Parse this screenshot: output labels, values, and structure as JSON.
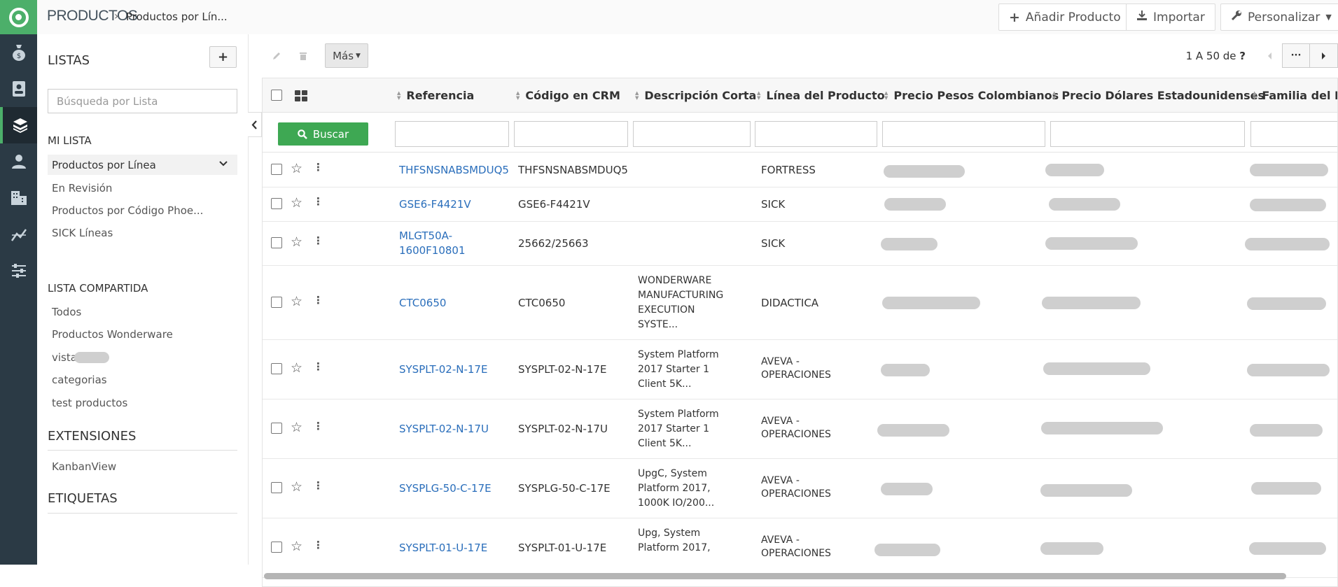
{
  "topbar": {
    "module": "PRODUCTOS",
    "breadcrumb": "Productos por Lín...",
    "add_label": "Añadir Producto",
    "import_label": "Importar",
    "customize_label": "Personalizar"
  },
  "sidebar": {
    "lists_title": "LISTAS",
    "add_symbol": "+",
    "search_placeholder": "Búsqueda por Lista",
    "my_list_title": "MI LISTA",
    "my_list": [
      "Productos por Línea",
      "En Revisión",
      "Productos por Código Phoe...",
      "SICK Líneas"
    ],
    "shared_title": "LISTA COMPARTIDA",
    "shared": [
      "Todos",
      "Productos Wonderware",
      "vista",
      "categorias",
      "test productos"
    ],
    "extensions_title": "EXTENSIONES",
    "extensions": [
      "KanbanView"
    ],
    "tags_title": "ETIQUETAS"
  },
  "toolbar": {
    "more_label": "Más",
    "pager_text": "1 A 50  de",
    "pager_total": "?",
    "more_dots": "···"
  },
  "table": {
    "columns": [
      "Referencia",
      "Código en CRM",
      "Descripción Corta",
      "Línea del Producto",
      "Precio Pesos Colombianos",
      "Precio Dólares Estadounidenses",
      "Familia del Pr"
    ],
    "search_label": "Buscar",
    "rows": [
      {
        "ref": "THFSNSNABSMDUQ5",
        "crm": "THFSNSNABSMDUQ5",
        "desc": "",
        "linea": "FORTRESS"
      },
      {
        "ref": "GSE6-F4421V",
        "crm": "GSE6-F4421V",
        "desc": "",
        "linea": "SICK"
      },
      {
        "ref": "MLGT50A-\n1600F10801",
        "crm": "25662/25663",
        "desc": "",
        "linea": "SICK"
      },
      {
        "ref": "CTC0650",
        "crm": "CTC0650",
        "desc": "WONDERWARE\nMANUFACTURING\nEXECUTION\nSYSTE...",
        "linea": "DIDACTICA"
      },
      {
        "ref": "SYSPLT-02-N-17E",
        "crm": "SYSPLT-02-N-17E",
        "desc": "System Platform\n2017 Starter 1\nClient 5K...",
        "linea": "AVEVA -\nOPERACIONES"
      },
      {
        "ref": "SYSPLT-02-N-17U",
        "crm": "SYSPLT-02-N-17U",
        "desc": "System Platform\n2017 Starter 1\nClient 5K...",
        "linea": "AVEVA -\nOPERACIONES"
      },
      {
        "ref": "SYSPLG-50-C-17E",
        "crm": "SYSPLG-50-C-17E",
        "desc": "UpgC, System\nPlatform 2017,\n1000K IO/200...",
        "linea": "AVEVA -\nOPERACIONES"
      },
      {
        "ref": "SYSPLT-01-U-17E",
        "crm": "SYSPLT-01-U-17E",
        "desc": "Upg, System\nPlatform 2017,",
        "linea": "AVEVA -\nOPERACIONES"
      }
    ]
  },
  "colors": {
    "brand": "#4caf6a",
    "rail": "#2b3a45",
    "link": "#2a6ebb",
    "search_btn": "#3ea853"
  },
  "icons": [
    "logo-icon",
    "money-bag-icon",
    "contact-card-icon",
    "products-box-icon",
    "user-icon",
    "building-icon",
    "chart-icon",
    "sliders-icon",
    "plus-icon",
    "download-icon",
    "wrench-icon",
    "pencil-icon",
    "trash-icon",
    "search-icon",
    "star-icon",
    "kebab-icon"
  ]
}
